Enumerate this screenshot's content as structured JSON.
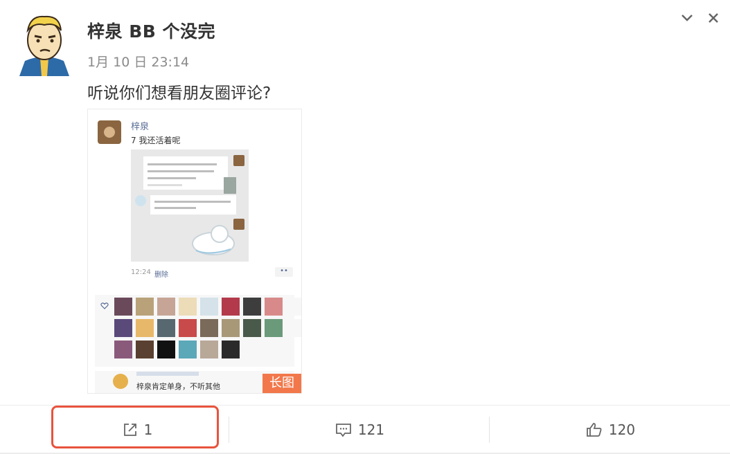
{
  "post": {
    "username": "梓泉 BB 个没完",
    "timestamp": "1月 10 日 23:14",
    "text": "听说你们想看朋友圈评论?",
    "avatar_icon": "cartoon-avatar-icon"
  },
  "image": {
    "name": "梓泉",
    "text": "7 我还活着呢",
    "time": "12:24",
    "delete_label": "删除",
    "dots": "••",
    "comment": "梓泉肯定单身，不听其他",
    "long_badge": "长图"
  },
  "actions": {
    "share_count": "1",
    "comment_count": "121",
    "like_count": "120"
  },
  "colors": {
    "highlight": "#e8533d",
    "badge": "#f2784b",
    "link": "#576b95"
  }
}
